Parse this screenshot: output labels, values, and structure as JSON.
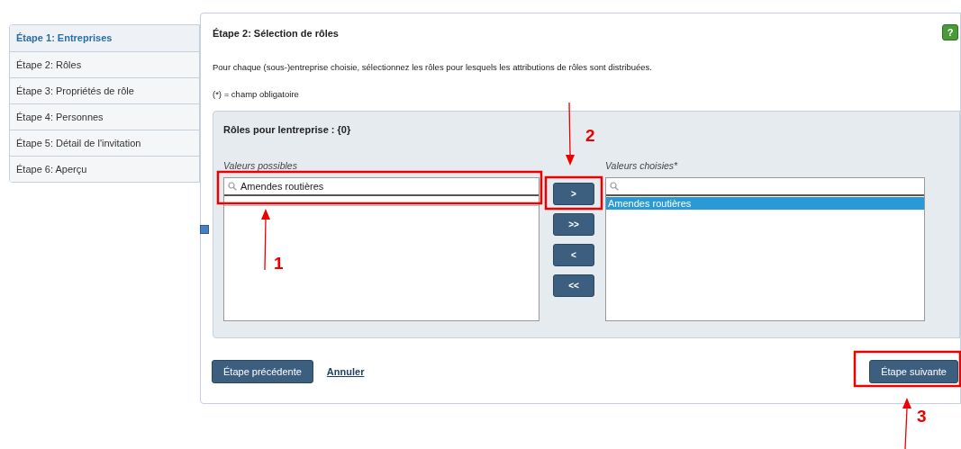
{
  "sidebar": {
    "items": [
      {
        "label": "Étape 1: Entreprises",
        "selected": true
      },
      {
        "label": "Étape 2: Rôles",
        "selected": false
      },
      {
        "label": "Étape 3: Propriétés de rôle",
        "selected": false
      },
      {
        "label": "Étape 4: Personnes",
        "selected": false
      },
      {
        "label": "Étape 5: Détail de l'invitation",
        "selected": false
      },
      {
        "label": "Étape 6: Aperçu",
        "selected": false
      }
    ]
  },
  "main": {
    "title": "Étape 2: Sélection de rôles",
    "help": "?",
    "description": "Pour chaque (sous-)entreprise choisie, sélectionnez les rôles pour lesquels les attributions de rôles sont distribuées.",
    "required_note": "(*) = champ obligatoire"
  },
  "picker": {
    "title": "Rôles pour lentreprise : {0}",
    "available": {
      "label": "Valeurs possibles",
      "search": "Amendes routières"
    },
    "move_buttons": [
      ">",
      ">>",
      "<",
      "<<"
    ],
    "chosen": {
      "label": "Valeurs choisies*",
      "items": [
        {
          "label": "Amendes routières",
          "selected": true
        }
      ]
    }
  },
  "footer": {
    "back": "Étape précédente",
    "cancel": "Annuler",
    "next": "Étape suivante"
  },
  "annotations": [
    {
      "number": "1"
    },
    {
      "number": "2"
    },
    {
      "number": "3"
    }
  ]
}
